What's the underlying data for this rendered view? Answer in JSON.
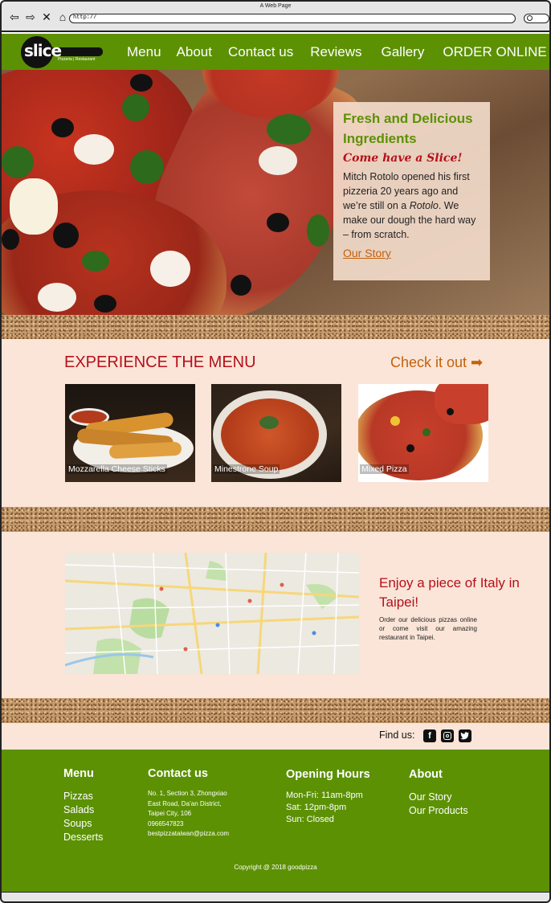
{
  "browser": {
    "window_title": "A Web Page",
    "url": "http://"
  },
  "nav": {
    "logo_text": "slice",
    "logo_sub": "Pizzeria | Restaurant",
    "links": [
      "Menu",
      "About",
      "Contact us",
      "Reviews",
      "Gallery",
      "ORDER ONLINE"
    ]
  },
  "hero": {
    "title": "Fresh and Delicious Ingredients",
    "tagline": "Come have a Slice!",
    "text_before": "Mitch Rotolo opened his first pizzeria 20 years ago and we’re still on a ",
    "text_italic": "Rotolo",
    "text_after": ". We make our dough the hard way – from scratch.",
    "link": "Our Story"
  },
  "menu_section": {
    "title": "EXPERIENCE THE MENU",
    "link": "Check it out ➡",
    "items": [
      {
        "caption": "Mozzarella Cheese Sticks"
      },
      {
        "caption": "Minestrone Soup"
      },
      {
        "caption": "Mixed Pizza"
      }
    ]
  },
  "location": {
    "title": "Enjoy a piece of Italy in Taipei!",
    "text": "Order our delicious pizzas online or come visit our amazing restaurant in Taipei."
  },
  "findus": {
    "label": "Find us:",
    "icons": [
      "facebook-icon",
      "instagram-icon",
      "twitter-icon"
    ]
  },
  "footer": {
    "menu": {
      "heading": "Menu",
      "items": [
        "Pizzas",
        "Salads",
        "Soups",
        "Desserts"
      ]
    },
    "contact": {
      "heading": "Contact us",
      "lines": [
        "No. 1, Section  3, Zhongxiao",
        "East Road,  Da’an District,",
        "Taipei City, 106",
        "0966547823",
        "bestpizzataiwan@pizza.com"
      ]
    },
    "hours": {
      "heading": "Opening Hours",
      "items": [
        "Mon-Fri: 11am-8pm",
        "Sat: 12pm-8pm",
        "Sun: Closed"
      ]
    },
    "about": {
      "heading": "About",
      "items": [
        "Our Story",
        "Our Products"
      ]
    },
    "copyright": "Copyright  @  2018 goodpizza"
  },
  "colors": {
    "brand_green": "#5c9104",
    "accent_red": "#b5101b",
    "accent_orange": "#c4600b",
    "section_bg": "#fae5d8"
  }
}
